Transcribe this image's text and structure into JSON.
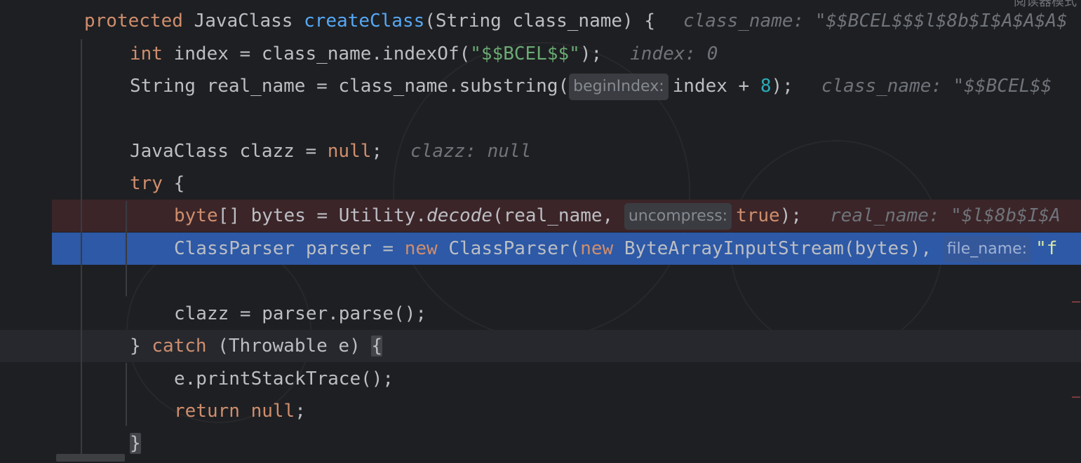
{
  "toolbar": {
    "mode_label": "阅读器模式"
  },
  "lines": {
    "l1": {
      "t1": "protected",
      "t2": " JavaClass ",
      "t3": "createClass",
      "t4": "(String class_name) {",
      "inline": "class_name: \"$$BCEL$$$l$8b$I$A$A$A$"
    },
    "l2": {
      "t1": "int",
      "t2": " index = class_name.indexOf(",
      "t3": "\"$$BCEL$$\"",
      "t4": ");",
      "inline": "index: 0"
    },
    "l3": {
      "t1": "String real_name = class_name.substring(",
      "hint": "beginIndex:",
      "t2": "index + ",
      "t3": "8",
      "t4": ");",
      "inline": "class_name: \"$$BCEL$$"
    },
    "l5": {
      "t1": "JavaClass clazz = ",
      "t2": "null",
      "t3": ";",
      "inline": "clazz: null"
    },
    "l6": {
      "t1": "try",
      "t2": " {"
    },
    "l7": {
      "t1": "byte",
      "t2": "[] bytes = Utility.",
      "t3": "decode",
      "t4": "(real_name, ",
      "hint": "uncompress:",
      "t5": "true",
      "t6": ");",
      "inline": "real_name: \"$l$8b$I$A"
    },
    "l8": {
      "t1": "ClassParser parser = ",
      "t2": "new",
      "t3": " ClassParser(",
      "t4": "new",
      "t5": " ByteArrayInputStream(bytes), ",
      "hint": "file_name:",
      "t6": "\"f"
    },
    "l10": {
      "t1": "clazz = parser.parse();"
    },
    "l11": {
      "t1": "} ",
      "t2": "catch",
      "t3": " (Throwable e) ",
      "t4": "{"
    },
    "l12": {
      "t1": "e.printStackTrace();"
    },
    "l13": {
      "t1": "return",
      "t2": " ",
      "t3": "null",
      "t4": ";"
    },
    "l14": {
      "t1": "}"
    }
  },
  "colors": {
    "background": "#1e1f22",
    "keyword": "#cf8e6d",
    "function": "#56a8f5",
    "string": "#6aab73",
    "number": "#2aacb8",
    "breakpoint_line": "#3b2528",
    "current_line": "#2d59a6",
    "inline_value": "#6f737a"
  }
}
